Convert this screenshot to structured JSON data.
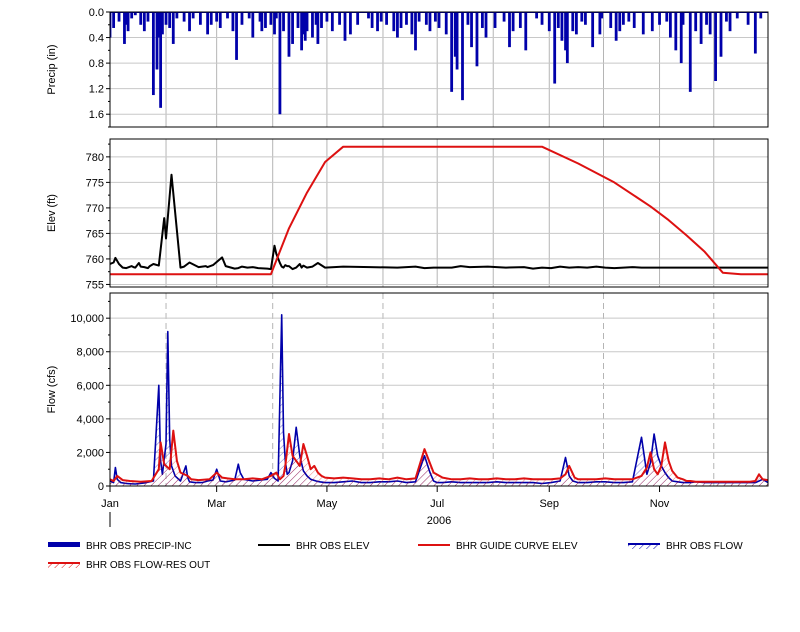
{
  "chart_data": [
    {
      "type": "bar",
      "ylabel": "Precip (in)",
      "ylim": [
        0,
        1.8
      ],
      "y_inverted": true,
      "yticks": [
        "0.0",
        "0.4",
        "0.8",
        "1.2",
        "1.6"
      ],
      "grid": true,
      "color": "#0000aa",
      "series": [
        {
          "name": "BHR OBS PRECIP-INC",
          "x": [
            1,
            3,
            6,
            9,
            10,
            11,
            13,
            15,
            18,
            20,
            22,
            25,
            27,
            28,
            29,
            30,
            32,
            34,
            36,
            38,
            42,
            45,
            47,
            51,
            55,
            57,
            60,
            62,
            66,
            69,
            71,
            74,
            78,
            80,
            84,
            85,
            87,
            90,
            92,
            93,
            95,
            97,
            100,
            102,
            105,
            107,
            108,
            109,
            110,
            113,
            115,
            116,
            118,
            121,
            124,
            128,
            131,
            134,
            138,
            144,
            146,
            149,
            151,
            154,
            158,
            160,
            162,
            165,
            168,
            170,
            172,
            176,
            178,
            181,
            183,
            187,
            190,
            192,
            193,
            196,
            199,
            201,
            204,
            207,
            209,
            214,
            219,
            222,
            224,
            228,
            231,
            237,
            240,
            244,
            247,
            249,
            251,
            253,
            254,
            257,
            259,
            262,
            264,
            268,
            272,
            273,
            278,
            281,
            283,
            285,
            288,
            291,
            296,
            301,
            305,
            309,
            311,
            314,
            317,
            318,
            322,
            325,
            328,
            331,
            333,
            336,
            339,
            342,
            344,
            348,
            354,
            358,
            361
          ],
          "values": [
            0.4,
            0.25,
            0.15,
            0.5,
            0.2,
            0.3,
            0.1,
            0.05,
            0.2,
            0.3,
            0.15,
            1.3,
            0.9,
            0.4,
            1.5,
            0.35,
            0.2,
            0.25,
            0.5,
            0.1,
            0.15,
            0.3,
            0.1,
            0.2,
            0.35,
            0.2,
            0.15,
            0.25,
            0.1,
            0.3,
            0.75,
            0.2,
            0.1,
            0.4,
            0.15,
            0.3,
            0.25,
            0.2,
            0.35,
            0.1,
            1.6,
            0.3,
            0.7,
            0.5,
            0.25,
            0.6,
            0.35,
            0.45,
            0.3,
            0.4,
            0.2,
            0.5,
            0.25,
            0.15,
            0.3,
            0.2,
            0.45,
            0.35,
            0.2,
            0.1,
            0.25,
            0.3,
            0.15,
            0.2,
            0.3,
            0.4,
            0.25,
            0.2,
            0.35,
            0.6,
            0.15,
            0.2,
            0.3,
            0.15,
            0.25,
            0.35,
            1.25,
            0.7,
            0.9,
            1.38,
            0.2,
            0.55,
            0.85,
            0.25,
            0.4,
            0.25,
            0.15,
            0.55,
            0.3,
            0.25,
            0.6,
            0.1,
            0.2,
            0.3,
            1.12,
            0.25,
            0.45,
            0.6,
            0.8,
            0.3,
            0.35,
            0.15,
            0.2,
            0.55,
            0.35,
            0.1,
            0.25,
            0.45,
            0.3,
            0.2,
            0.15,
            0.25,
            0.35,
            0.3,
            0.2,
            0.15,
            0.4,
            0.6,
            0.8,
            0.2,
            1.25,
            0.3,
            0.5,
            0.2,
            0.35,
            1.08,
            0.7,
            0.15,
            0.3,
            0.1,
            0.2,
            0.65,
            0.1
          ]
        }
      ]
    },
    {
      "type": "line",
      "ylabel": "Elev (ft)",
      "ylim": [
        754.5,
        783.5
      ],
      "yticks": [
        "755",
        "760",
        "765",
        "770",
        "775",
        "780"
      ],
      "grid": true,
      "series": [
        {
          "name": "BHR OBS ELEV",
          "color": "#000000",
          "x": [
            1,
            3,
            4,
            6,
            8,
            10,
            13,
            14,
            15,
            17,
            18,
            20,
            22,
            23,
            25,
            28,
            31,
            32,
            35,
            40,
            42,
            45,
            50,
            54,
            55,
            58,
            63,
            65,
            68,
            70,
            72,
            74,
            77,
            80,
            83,
            88,
            90,
            92,
            93,
            95,
            96,
            97,
            98,
            99,
            100,
            102,
            104,
            106,
            107,
            108,
            110,
            113,
            116,
            120,
            130,
            145,
            160,
            170,
            175,
            180,
            190,
            195,
            200,
            210,
            220,
            230,
            235,
            240,
            245,
            250,
            255,
            260,
            265,
            270,
            275,
            280,
            285,
            290,
            295,
            297,
            299,
            300,
            302,
            304,
            306,
            309,
            312,
            318,
            321,
            325,
            330,
            335,
            340,
            345,
            350,
            355,
            358,
            361,
            365
          ],
          "values": [
            759,
            759.3,
            760.2,
            759,
            758.3,
            758.2,
            758.6,
            758.4,
            758.3,
            759.2,
            758.5,
            758.4,
            758.2,
            758.6,
            759,
            758.7,
            768,
            764,
            776.5,
            758.3,
            758.5,
            759.3,
            758.4,
            758.6,
            758.4,
            758.8,
            760.3,
            758.6,
            758.3,
            758.1,
            758.2,
            758.5,
            758.3,
            758.4,
            758.2,
            758.1,
            758,
            762.6,
            761,
            759.2,
            758.5,
            758.3,
            758.8,
            758.6,
            758.6,
            758,
            758.3,
            759,
            758.3,
            758.7,
            758.3,
            758.5,
            759.2,
            758.3,
            758.5,
            758.4,
            758.3,
            758.5,
            758.2,
            758.3,
            758.3,
            758.6,
            758.4,
            758.5,
            758.3,
            758.4,
            758.1,
            758.3,
            758.2,
            758.5,
            758.3,
            758.4,
            758.3,
            758.5,
            758.3,
            758.2,
            758.3,
            758.4,
            758.3,
            758.3,
            758.3,
            758.3,
            758.3,
            758.3,
            758.3,
            758.3,
            758.3,
            758.3,
            758.3,
            758.3,
            758.3,
            758.3,
            758.3,
            758.3,
            758.3,
            758.3,
            758.3,
            758.3,
            758.3
          ]
        },
        {
          "name": "BHR GUIDE CURVE ELEV",
          "color": "#dd1111",
          "x": [
            1,
            90,
            100,
            110,
            120,
            130,
            140,
            190,
            240,
            260,
            280,
            300,
            310,
            320,
            330,
            340,
            350,
            365
          ],
          "values": [
            757,
            757,
            766,
            773,
            779,
            782,
            782,
            782,
            782,
            778.7,
            775,
            770.3,
            767.6,
            764.6,
            761.4,
            757.3,
            757,
            757
          ]
        }
      ]
    },
    {
      "type": "line",
      "ylabel": "Flow (cfs)",
      "ylim": [
        0,
        11500
      ],
      "yticks": [
        "0",
        "2,000",
        "4,000",
        "6,000",
        "8,000",
        "10,000"
      ],
      "xlabel": "2006",
      "xticks": [
        "Jan",
        "Mar",
        "May",
        "Jul",
        "Sep",
        "Nov"
      ],
      "grid": true,
      "series": [
        {
          "name": "BHR OBS FLOW",
          "color": "#0000aa",
          "x": [
            1,
            3,
            4,
            5,
            7,
            10,
            15,
            20,
            25,
            28,
            29,
            30,
            32,
            33,
            34,
            35,
            37,
            40,
            43,
            44,
            45,
            48,
            52,
            55,
            58,
            60,
            62,
            65,
            70,
            72,
            73,
            75,
            80,
            84,
            88,
            90,
            92,
            94,
            96,
            97,
            98,
            99,
            100,
            102,
            104,
            106,
            108,
            110,
            112,
            115,
            117,
            120,
            125,
            130,
            135,
            140,
            145,
            150,
            155,
            160,
            165,
            170,
            175,
            178,
            180,
            182,
            185,
            190,
            195,
            200,
            205,
            210,
            215,
            220,
            225,
            230,
            235,
            240,
            245,
            250,
            253,
            255,
            257,
            260,
            265,
            270,
            275,
            280,
            285,
            290,
            295,
            298,
            300,
            302,
            304,
            306,
            308,
            310,
            312,
            315,
            318,
            320,
            322,
            325,
            330,
            335,
            340,
            345,
            350,
            355,
            358,
            360,
            362,
            365
          ],
          "values": [
            300,
            200,
            1100,
            400,
            200,
            150,
            120,
            180,
            300,
            6000,
            1500,
            700,
            2500,
            9200,
            2800,
            1200,
            600,
            300,
            1200,
            500,
            250,
            200,
            200,
            300,
            350,
            1000,
            300,
            250,
            350,
            1300,
            800,
            400,
            300,
            350,
            400,
            800,
            450,
            300,
            10200,
            3200,
            1500,
            700,
            800,
            1500,
            3500,
            1800,
            900,
            600,
            400,
            300,
            250,
            200,
            200,
            250,
            300,
            200,
            200,
            250,
            250,
            300,
            200,
            250,
            1800,
            800,
            300,
            200,
            200,
            250,
            200,
            200,
            200,
            200,
            250,
            200,
            200,
            200,
            200,
            150,
            200,
            300,
            1700,
            600,
            300,
            200,
            200,
            250,
            250,
            200,
            200,
            250,
            2900,
            700,
            1400,
            3100,
            1800,
            1200,
            800,
            500,
            300,
            250,
            200,
            200,
            200,
            250,
            200,
            200,
            200,
            200,
            200,
            200,
            200,
            300,
            400,
            200
          ]
        },
        {
          "name": "BHR OBS FLOW-RES OUT",
          "color": "#dd1111",
          "x": [
            1,
            3,
            5,
            8,
            12,
            18,
            24,
            28,
            29,
            31,
            34,
            36,
            38,
            40,
            44,
            46,
            50,
            56,
            60,
            63,
            66,
            70,
            75,
            80,
            85,
            90,
            93,
            95,
            97,
            98,
            100,
            102,
            104,
            106,
            108,
            110,
            112,
            114,
            116,
            118,
            120,
            125,
            130,
            135,
            140,
            145,
            150,
            155,
            160,
            165,
            170,
            175,
            180,
            185,
            190,
            195,
            200,
            205,
            210,
            215,
            220,
            225,
            230,
            235,
            240,
            245,
            250,
            253,
            255,
            258,
            260,
            265,
            270,
            275,
            280,
            285,
            290,
            295,
            298,
            300,
            302,
            304,
            306,
            308,
            310,
            312,
            315,
            318,
            320,
            322,
            325,
            330,
            335,
            340,
            345,
            350,
            355,
            358,
            360,
            362,
            365
          ],
          "values": [
            400,
            300,
            600,
            350,
            300,
            250,
            300,
            1000,
            2600,
            1300,
            1000,
            3300,
            1500,
            800,
            600,
            400,
            350,
            400,
            800,
            500,
            450,
            400,
            400,
            450,
            400,
            600,
            800,
            400,
            600,
            1200,
            3100,
            1800,
            1500,
            1200,
            2500,
            1800,
            1000,
            1200,
            800,
            600,
            500,
            450,
            500,
            450,
            400,
            400,
            450,
            400,
            500,
            400,
            450,
            2200,
            800,
            500,
            400,
            400,
            450,
            400,
            400,
            450,
            400,
            400,
            450,
            400,
            400,
            400,
            450,
            700,
            1200,
            500,
            400,
            400,
            400,
            450,
            400,
            400,
            400,
            600,
            1100,
            2000,
            1000,
            700,
            1200,
            2600,
            1500,
            900,
            500,
            400,
            300,
            300,
            250,
            250,
            250,
            250,
            250,
            250,
            250,
            300,
            700,
            400,
            350
          ]
        }
      ]
    }
  ],
  "legend": [
    {
      "label": "BHR OBS PRECIP-INC",
      "style": "thick-line",
      "color": "#0000aa"
    },
    {
      "label": "BHR OBS ELEV",
      "style": "line",
      "color": "#000000"
    },
    {
      "label": "BHR GUIDE CURVE ELEV",
      "style": "line",
      "color": "#dd1111"
    },
    {
      "label": "BHR OBS FLOW",
      "style": "hatched-line",
      "color": "#0000aa"
    },
    {
      "label": "BHR OBS FLOW-RES OUT",
      "style": "hatched-line",
      "color": "#dd1111"
    }
  ],
  "x_axis": {
    "range_days": [
      1,
      365
    ],
    "tick_labels": [
      "Jan",
      "Mar",
      "May",
      "Jul",
      "Sep",
      "Nov"
    ],
    "year_label": "2006"
  }
}
